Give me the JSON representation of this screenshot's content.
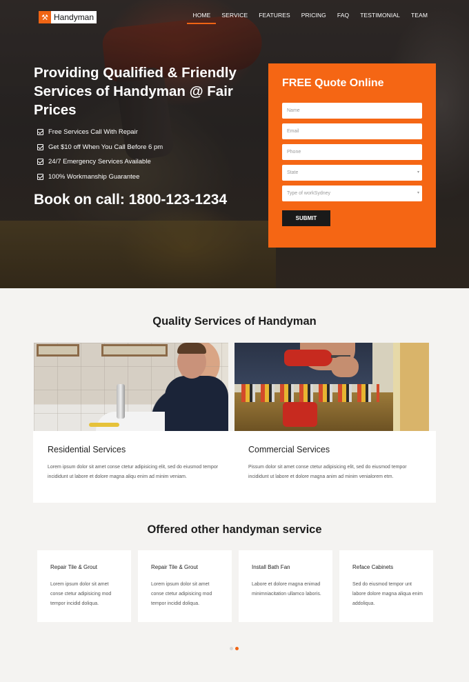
{
  "brand": {
    "name": "Handyman",
    "logo_icon": "wrench-hammer-icon",
    "accent_color": "#f56614"
  },
  "nav": {
    "items": [
      {
        "label": "HOME",
        "active": true
      },
      {
        "label": "SERVICE",
        "active": false
      },
      {
        "label": "FEATURES",
        "active": false
      },
      {
        "label": "PRICING",
        "active": false
      },
      {
        "label": "FAQ",
        "active": false
      },
      {
        "label": "TESTIMONIAL",
        "active": false
      },
      {
        "label": "TEAM",
        "active": false
      }
    ]
  },
  "hero": {
    "title": "Providing Qualified & Friendly Services of Handyman @ Fair Prices",
    "features": [
      "Free Services Call With Repair",
      "Get $10 off When You Call Before 6 pm",
      "24/7 Emergency Services Available",
      "100% Workmanship Guarantee"
    ],
    "book_call": "Book on call: 1800-123-1234"
  },
  "quote_form": {
    "title": "FREE Quote Online",
    "fields": {
      "name_placeholder": "Name",
      "email_placeholder": "Email",
      "phone_placeholder": "Phone",
      "state_selected": "State",
      "work_type_selected": "Type of workSydney"
    },
    "submit_label": "SUBMIT"
  },
  "quality_services": {
    "heading": "Quality Services of Handyman",
    "cards": [
      {
        "title": "Residential Services",
        "description": "Lorem ipsum dolor sit amet conse ctetur adipisicing elit, sed do eiusmod tempor incididunt ut labore et dolore magna aliqu enim ad minim veniam."
      },
      {
        "title": "Commercial Services",
        "description": "Pissum dolor sit amet conse ctetur adipisicing elit, sed do eiusmod tempor incididunt ut labore et dolore magna anim ad minim venialorem etm."
      }
    ]
  },
  "other_services": {
    "heading": "Offered other handyman service",
    "cards": [
      {
        "title": "Repair Tile & Grout",
        "description": "Lorem ipsum dolor sit amet conse ctetur adipisicing mod tempor incidid doliqua."
      },
      {
        "title": "Repair Tile & Grout",
        "description": "Lorem ipsum dolor sit amet conse ctetur adipisicing mod tempor incidid doliqua."
      },
      {
        "title": "Install Bath Fan",
        "description": "Labore et dolore magna enimad minimniacitation ullamco laboris."
      },
      {
        "title": "Reface Cabinets",
        "description": "Sed do eiusmod tempor unt labore dolore magna aliqua enim addoliqua."
      }
    ],
    "carousel": {
      "pages": 2,
      "active_page": 2
    }
  }
}
